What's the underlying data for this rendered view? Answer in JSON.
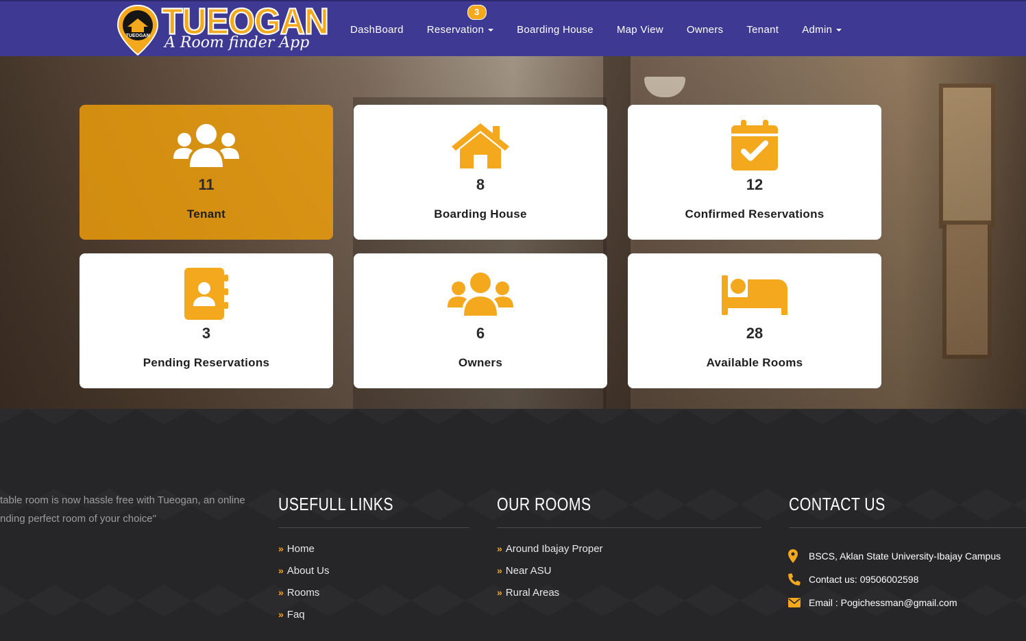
{
  "brand": {
    "title": "TUEOGAN",
    "subtitle": "A Room finder App",
    "badge_text": "TUEOGAN",
    "colors": {
      "nav_bg": "#3e3a93",
      "accent": "#f4a81d",
      "card_active": "#f0a00a",
      "footer_bg": "#262628"
    }
  },
  "nav": {
    "items": [
      {
        "label": "DashBoard",
        "icon": ""
      },
      {
        "label": "Reservation",
        "badge": "3",
        "dropdown": true
      },
      {
        "label": "Boarding House"
      },
      {
        "label": "Map View"
      },
      {
        "label": "Owners"
      },
      {
        "label": "Tenant"
      },
      {
        "label": "Admin",
        "dropdown": true
      }
    ]
  },
  "cards": [
    {
      "icon": "users-icon",
      "count": "11",
      "label": "Tenant",
      "active": true
    },
    {
      "icon": "house-icon",
      "count": "8",
      "label": "Boarding House"
    },
    {
      "icon": "calendar-check-icon",
      "count": "12",
      "label": "Confirmed Reservations"
    },
    {
      "icon": "address-book-icon",
      "count": "3",
      "label": "Pending Reservations"
    },
    {
      "icon": "users-icon",
      "count": "6",
      "label": "Owners"
    },
    {
      "icon": "bed-icon",
      "count": "28",
      "label": "Available Rooms"
    }
  ],
  "footer": {
    "about": {
      "line1": "table room is now hassle free with Tueogan, an online",
      "line2": "nding perfect room of your choice\""
    },
    "useful_links": {
      "title": "USEFULL LINKS",
      "items": [
        "Home",
        "About Us",
        "Rooms",
        "Faq"
      ]
    },
    "our_rooms": {
      "title": "OUR ROOMS",
      "items": [
        "Around Ibajay Proper",
        "Near ASU",
        "Rural Areas"
      ]
    },
    "contact": {
      "title": "CONTACT US",
      "address": "BSCS, Aklan State University-Ibajay Campus",
      "phone": "Contact us: 09506002598",
      "email": "Email : Pogichessman@gmail.com"
    }
  }
}
